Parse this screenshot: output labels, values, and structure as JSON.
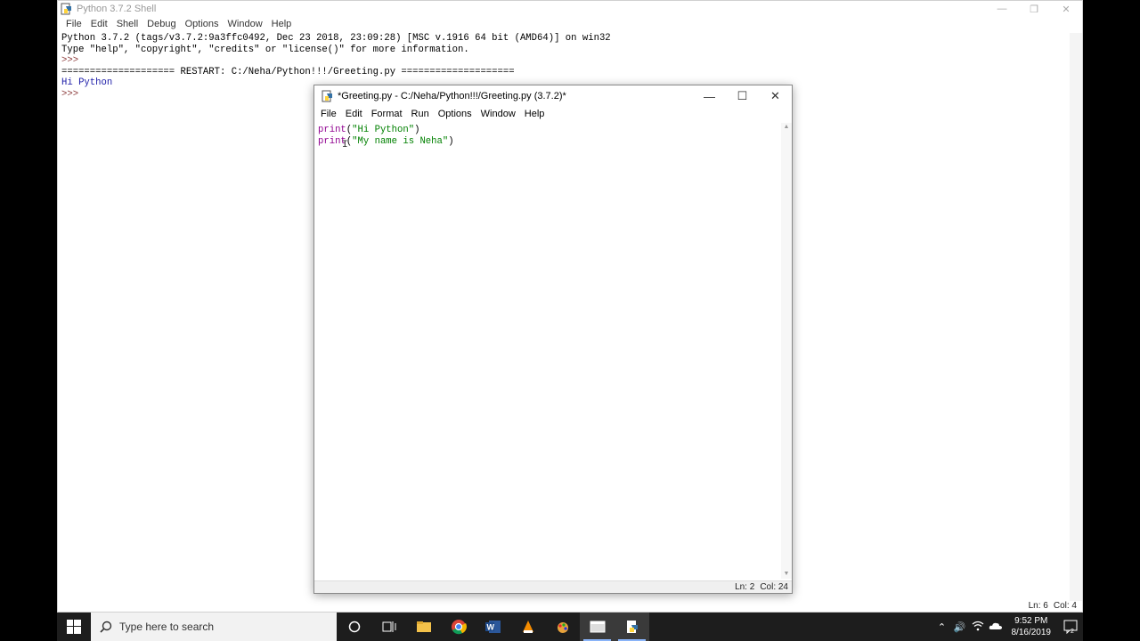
{
  "shell": {
    "title": "Python 3.7.2 Shell",
    "menu": [
      "File",
      "Edit",
      "Shell",
      "Debug",
      "Options",
      "Window",
      "Help"
    ],
    "lines": [
      "Python 3.7.2 (tags/v3.7.2:9a3ffc0492, Dec 23 2018, 23:09:28) [MSC v.1916 64 bit (AMD64)] on win32",
      "Type \"help\", \"copyright\", \"credits\" or \"license()\" for more information.",
      ">>> ",
      "==================== RESTART: C:/Neha/Python!!!/Greeting.py ====================",
      "Hi Python",
      ">>> "
    ],
    "status": {
      "line": "Ln: 6",
      "col": "Col: 4"
    }
  },
  "editor": {
    "title": "*Greeting.py - C:/Neha/Python!!!/Greeting.py (3.7.2)*",
    "menu": [
      "File",
      "Edit",
      "Format",
      "Run",
      "Options",
      "Window",
      "Help"
    ],
    "code": [
      {
        "kw": "print",
        "open": "(",
        "str": "\"Hi Python\"",
        "close": ")"
      },
      {
        "kw": "print",
        "open": "(",
        "str": "\"My name is Neha\"",
        "close": ")"
      }
    ],
    "status": {
      "line": "Ln: 2",
      "col": "Col: 24"
    }
  },
  "taskbar": {
    "search_placeholder": "Type here to search",
    "time": "9:52 PM",
    "date": "8/16/2019",
    "icons": [
      "cortana-icon",
      "task-view-icon",
      "file-explorer-icon",
      "chrome-icon",
      "word-icon",
      "vlc-icon",
      "paint-icon",
      "idle-shell-icon",
      "idle-editor-icon"
    ]
  },
  "colors": {
    "keyword": "#900090",
    "string": "#008000",
    "shell_output": "#1c1ca8",
    "taskbar": "#1d1d1d"
  }
}
